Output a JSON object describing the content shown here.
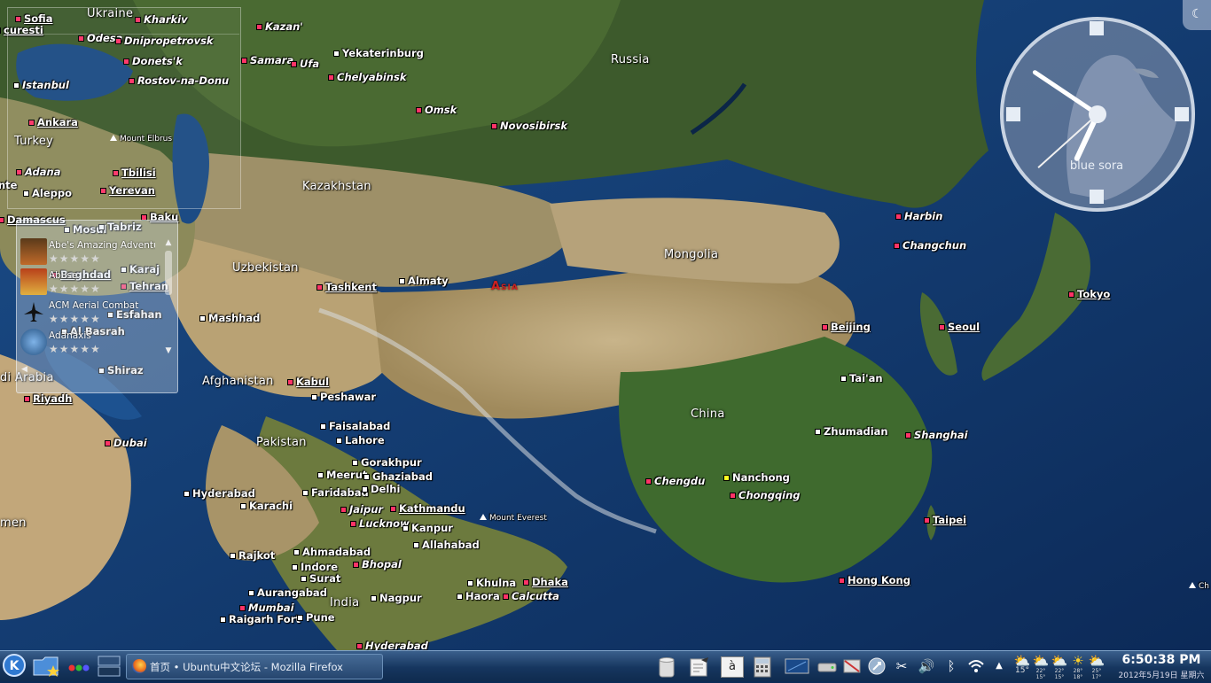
{
  "map": {
    "regions": [
      "Ukraine",
      "Russia",
      "Kazakhstan",
      "Turkey",
      "Uzbekistan",
      "Mongolia",
      "Afghanistan",
      "China",
      "Pakistan",
      "India",
      "di Arabia",
      "men"
    ],
    "continent_label": "Asia",
    "places": [
      {
        "id": "sofia",
        "label": "Sofia",
        "style": "cap red"
      },
      {
        "id": "bucuresti",
        "label": "curesti",
        "style": "cap red"
      },
      {
        "id": "kharkiv",
        "label": "Kharkiv",
        "style": "it red"
      },
      {
        "id": "odesa",
        "label": "Odesa",
        "style": "it red"
      },
      {
        "id": "dnipro",
        "label": "Dnipropetrovsk",
        "style": "it red"
      },
      {
        "id": "donetsk",
        "label": "Donets'k",
        "style": "it red"
      },
      {
        "id": "rostov",
        "label": "Rostov-na-Donu",
        "style": "it red"
      },
      {
        "id": "istanbul",
        "label": "Istanbul",
        "style": "it white"
      },
      {
        "id": "ankara",
        "label": "Ankara",
        "style": "cap red"
      },
      {
        "id": "elbrus",
        "label": "Mount Elbrus",
        "style": "mtn"
      },
      {
        "id": "adana",
        "label": "Adana",
        "style": "it red"
      },
      {
        "id": "tbilisi",
        "label": "Tbilisi",
        "style": "cap red"
      },
      {
        "id": "yerevan",
        "label": "Yerevan",
        "style": "cap red"
      },
      {
        "id": "aleppo",
        "label": "Aleppo",
        "style": "white"
      },
      {
        "id": "ante",
        "label": "nte",
        "style": "white"
      },
      {
        "id": "damascus",
        "label": "Damascus",
        "style": "cap red"
      },
      {
        "id": "baku",
        "label": "Baku",
        "style": "cap red"
      },
      {
        "id": "mosul",
        "label": "Mosul",
        "style": "white"
      },
      {
        "id": "tabriz",
        "label": "Tabriz",
        "style": "white"
      },
      {
        "id": "baghdad",
        "label": "Baghdad",
        "style": "cap red"
      },
      {
        "id": "karaj",
        "label": "Karaj",
        "style": "white"
      },
      {
        "id": "tehran",
        "label": "Tehran",
        "style": "cap red"
      },
      {
        "id": "esfahan",
        "label": "Esfahan",
        "style": "white"
      },
      {
        "id": "albasrah",
        "label": "Al Basrah",
        "style": "white"
      },
      {
        "id": "shiraz",
        "label": "Shiraz",
        "style": "white"
      },
      {
        "id": "riyadh",
        "label": "Riyadh",
        "style": "cap red"
      },
      {
        "id": "dubai",
        "label": "Dubai",
        "style": "it red"
      },
      {
        "id": "kazan",
        "label": "Kazan'",
        "style": "it red"
      },
      {
        "id": "samara",
        "label": "Samara",
        "style": "it red"
      },
      {
        "id": "ufa",
        "label": "Ufa",
        "style": "it red"
      },
      {
        "id": "yekaterinburg",
        "label": "Yekaterinburg",
        "style": "white"
      },
      {
        "id": "chelyabinsk",
        "label": "Chelyabinsk",
        "style": "it red"
      },
      {
        "id": "omsk",
        "label": "Omsk",
        "style": "it red"
      },
      {
        "id": "novosibirsk",
        "label": "Novosibirsk",
        "style": "it red"
      },
      {
        "id": "tashkent",
        "label": "Tashkent",
        "style": "cap red"
      },
      {
        "id": "almaty",
        "label": "Almaty",
        "style": "white"
      },
      {
        "id": "mashhad",
        "label": "Mashhad",
        "style": "white"
      },
      {
        "id": "kabul",
        "label": "Kabul",
        "style": "cap red"
      },
      {
        "id": "peshawar",
        "label": "Peshawar",
        "style": "white"
      },
      {
        "id": "faisalabad",
        "label": "Faisalabad",
        "style": "white"
      },
      {
        "id": "lahore",
        "label": "Lahore",
        "style": "white"
      },
      {
        "id": "gorakhpur",
        "label": "Gorakhpur",
        "style": "white"
      },
      {
        "id": "meerut",
        "label": "Meerut",
        "style": "white"
      },
      {
        "id": "ghaziabad",
        "label": "Ghaziabad",
        "style": "white"
      },
      {
        "id": "faridabad",
        "label": "Faridabad",
        "style": "white"
      },
      {
        "id": "delhi",
        "label": "Delhi",
        "style": "white"
      },
      {
        "id": "hyderabad_pk",
        "label": "Hyderabad",
        "style": "white"
      },
      {
        "id": "karachi",
        "label": "Karachi",
        "style": "white"
      },
      {
        "id": "jaipur",
        "label": "Jaipur",
        "style": "it red"
      },
      {
        "id": "kathmandu",
        "label": "Kathmandu",
        "style": "cap red"
      },
      {
        "id": "everest",
        "label": "Mount Everest",
        "style": "mtn"
      },
      {
        "id": "lucknow",
        "label": "Lucknow",
        "style": "it red"
      },
      {
        "id": "kanpur",
        "label": "Kanpur",
        "style": "white"
      },
      {
        "id": "allahabad",
        "label": "Allahabad",
        "style": "white"
      },
      {
        "id": "rajkot",
        "label": "Rajkot",
        "style": "white"
      },
      {
        "id": "ahmadabad",
        "label": "Ahmadabad",
        "style": "white"
      },
      {
        "id": "indore",
        "label": "Indore",
        "style": "white"
      },
      {
        "id": "bhopal",
        "label": "Bhopal",
        "style": "it red"
      },
      {
        "id": "surat",
        "label": "Surat",
        "style": "white"
      },
      {
        "id": "aurangabad",
        "label": "Aurangabad",
        "style": "white"
      },
      {
        "id": "mumbai",
        "label": "Mumbai",
        "style": "it red"
      },
      {
        "id": "raigarh",
        "label": "Raigarh Fort",
        "style": "white"
      },
      {
        "id": "pune",
        "label": "Pune",
        "style": "white"
      },
      {
        "id": "nagpur",
        "label": "Nagpur",
        "style": "white"
      },
      {
        "id": "hyderabad_in",
        "label": "Hyderabad",
        "style": "it red"
      },
      {
        "id": "khulna",
        "label": "Khulna",
        "style": "white"
      },
      {
        "id": "dhaka",
        "label": "Dhaka",
        "style": "cap red"
      },
      {
        "id": "haora",
        "label": "Haora",
        "style": "white"
      },
      {
        "id": "calcutta",
        "label": "Calcutta",
        "style": "it red"
      },
      {
        "id": "chengdu",
        "label": "Chengdu",
        "style": "it red"
      },
      {
        "id": "nanchong",
        "label": "Nanchong",
        "style": "yellow"
      },
      {
        "id": "chongqing",
        "label": "Chongqing",
        "style": "it red"
      },
      {
        "id": "harbin",
        "label": "Harbin",
        "style": "it red"
      },
      {
        "id": "changchun",
        "label": "Changchun",
        "style": "it red"
      },
      {
        "id": "beijing",
        "label": "Beijing",
        "style": "cap red"
      },
      {
        "id": "seoul",
        "label": "Seoul",
        "style": "cap red"
      },
      {
        "id": "tokyo",
        "label": "Tokyo",
        "style": "cap red"
      },
      {
        "id": "taian",
        "label": "Tai'an",
        "style": "white"
      },
      {
        "id": "zhumadian",
        "label": "Zhumadian",
        "style": "white"
      },
      {
        "id": "shanghai",
        "label": "Shanghai",
        "style": "it red"
      },
      {
        "id": "taipei",
        "label": "Taipei",
        "style": "cap red"
      },
      {
        "id": "hongkong",
        "label": "Hong Kong",
        "style": "cap red"
      },
      {
        "id": "ch",
        "label": "Ch",
        "style": "mtn"
      }
    ]
  },
  "game_widget": {
    "games": [
      {
        "title": "Abe's Amazing Adventure",
        "rating": 0
      },
      {
        "title": "Abuse",
        "rating": 0
      },
      {
        "title": "ACM Aerial Combat",
        "rating": 0
      },
      {
        "title": "Adanaxis",
        "rating": 0
      }
    ],
    "star_glyph": "★★★★★"
  },
  "clock_widget": {
    "theme_text": "blue sora",
    "hour": 6,
    "minute": 50,
    "second": 38
  },
  "panel": {
    "kde_menu_icon": "kde-logo-icon",
    "taskbar": [
      {
        "label": "首页 • Ubuntu中文论坛 - Mozilla Firefox",
        "icon": "firefox-icon"
      }
    ],
    "weather": [
      {
        "icon": "cloud-sun-icon",
        "temp": "15°"
      },
      {
        "icon": "cloud-sun-icon",
        "temp": "22° 15°"
      },
      {
        "icon": "cloud-sun-icon",
        "temp": "22° 15°"
      },
      {
        "icon": "cloud-sun-icon",
        "temp": "22° 15°"
      },
      {
        "icon": "sun-icon",
        "temp": "28° 18°"
      },
      {
        "icon": "cloud-sun-icon",
        "temp": "25° 17°"
      }
    ],
    "time": "6:50:38 PM",
    "date": "2012年5月19日 星期六",
    "kbd_letter": "à",
    "colors": {
      "panel_top": "#3a5f8c",
      "panel_bottom": "#0f2b4e",
      "marker_red": "#ff3366",
      "continent": "#d02020"
    }
  }
}
